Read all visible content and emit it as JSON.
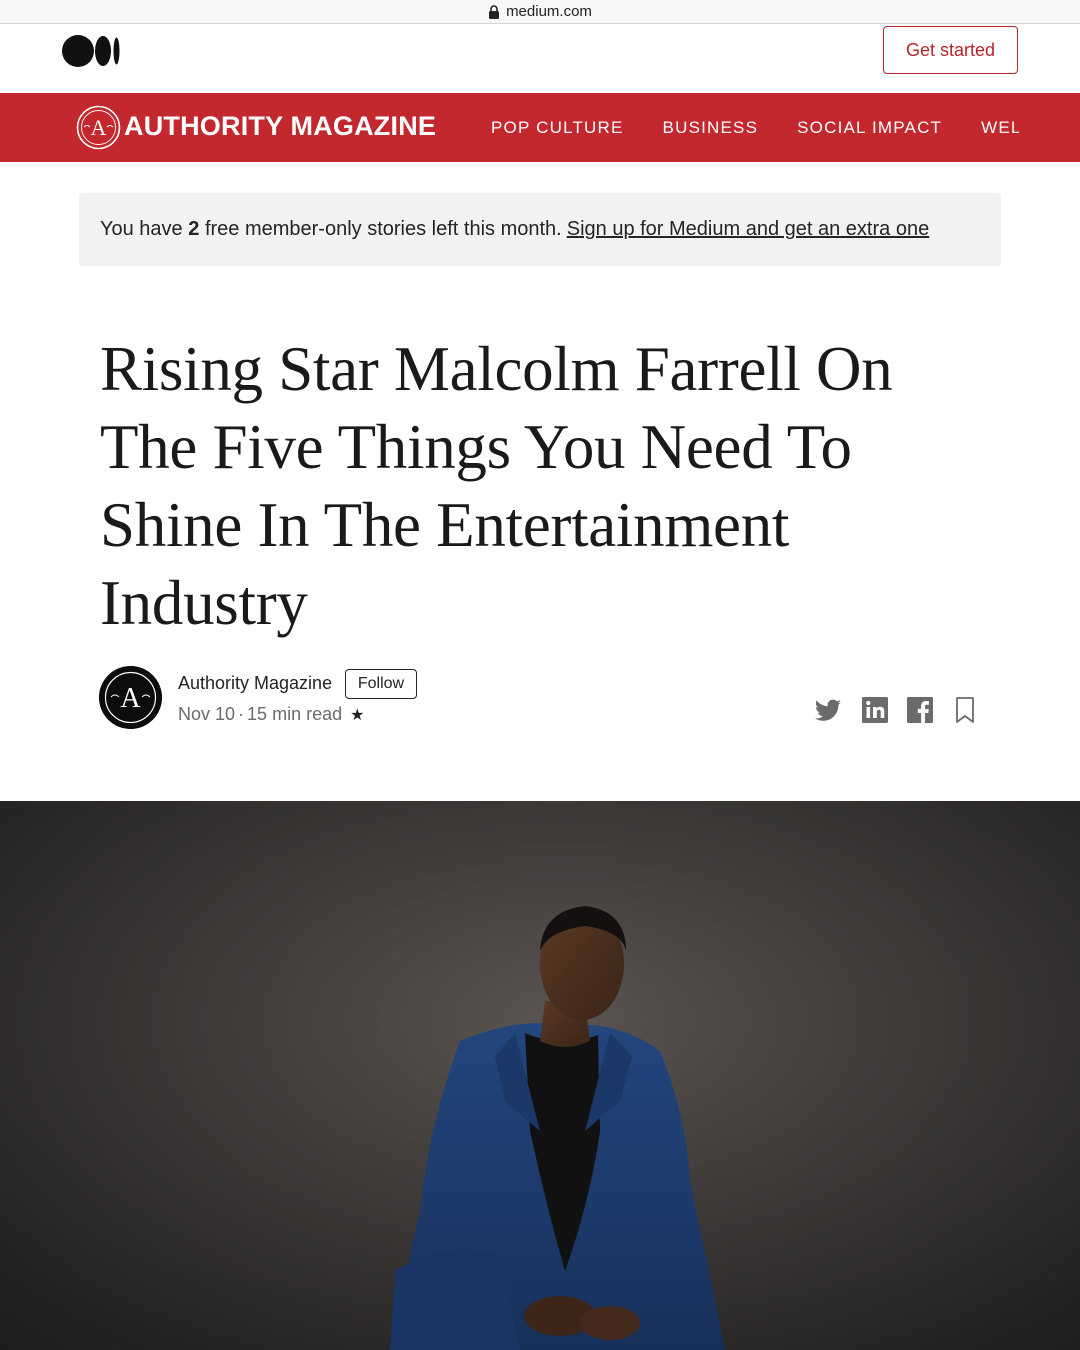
{
  "browser": {
    "url": "medium.com",
    "lock_icon": "lock-icon"
  },
  "header": {
    "logo_icon": "medium-logo-icon",
    "get_started_label": "Get started"
  },
  "publication": {
    "name": "AUTHORITY MAGAZINE",
    "emblem_icon": "authority-emblem-icon",
    "tabs": [
      "POP CULTURE",
      "BUSINESS",
      "SOCIAL IMPACT",
      "WELLNESS"
    ],
    "color": "#c2282e"
  },
  "banner": {
    "text_before": "You have",
    "count": "2",
    "text_after": "free member-only stories left this month.",
    "link_label": "Sign up for Medium and get an extra one"
  },
  "article": {
    "title": "Rising Star Malcolm Farrell On The Five Things You Need To Shine In The Entertainment Industry",
    "author": "Authority Magazine",
    "follow_label": "Follow",
    "date": "Nov 10",
    "separator": "·",
    "read_time": "15 min read",
    "star": "★",
    "share_icons": [
      "twitter-icon",
      "linkedin-icon",
      "facebook-icon",
      "bookmark-icon"
    ]
  },
  "hero": {
    "image_icon": "hero-portrait-image"
  },
  "colors": {
    "accent": "#c2282e",
    "text": "#242424",
    "muted": "#6b6b6b",
    "banner_bg": "#f2f2f2"
  }
}
